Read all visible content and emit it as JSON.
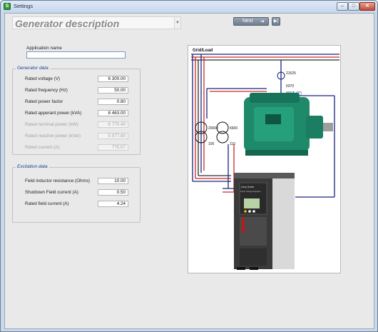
{
  "window": {
    "title": "Settings",
    "icon": "app-icon",
    "minimize": "–",
    "maximize": "□",
    "close": "✕"
  },
  "header": {
    "title": "Generator description",
    "next_label": "Next",
    "next_icon": "arrow-right-icon",
    "last_icon": "skip-to-end-icon"
  },
  "application": {
    "name_label": "Application name",
    "name_value": ""
  },
  "generator": {
    "title": "Generator data",
    "fields": [
      {
        "label": "Rated voltage (V)",
        "value": "6 300.00"
      },
      {
        "label": "Rated frequency (Hz)",
        "value": "50.00"
      },
      {
        "label": "Rated power factor",
        "value": "0.80"
      },
      {
        "label": "Rated apperant power (kVA)",
        "value": "8 463.00"
      },
      {
        "label": "Rated nominal power (kW)",
        "value": "6 770.40"
      },
      {
        "label": "Rated reactive power (kVar)",
        "value": "5 077.80"
      },
      {
        "label": "Rated current (A)",
        "value": "775.57"
      }
    ]
  },
  "excitation": {
    "title": "Excitation data",
    "fields": [
      {
        "label": "Field inductor resistance (Ohms)",
        "value": "10.00"
      },
      {
        "label": "Shutdown Field current (A)",
        "value": "0.50"
      },
      {
        "label": "Rated field current (A)",
        "value": "4.24"
      }
    ]
  },
  "diagram": {
    "grid_label": "Grid/Load",
    "ct_top_label": "21525",
    "ct_mid_label": "6370",
    "ct_ratio_label": "800/5 (0°)",
    "tx1_top": "20000",
    "tx1_bottom": "100",
    "tx2_top": "6600",
    "tx2_bottom": "110",
    "drive_brand": "Leroy Somer",
    "drive_model": "Power Voltage Regulator"
  }
}
